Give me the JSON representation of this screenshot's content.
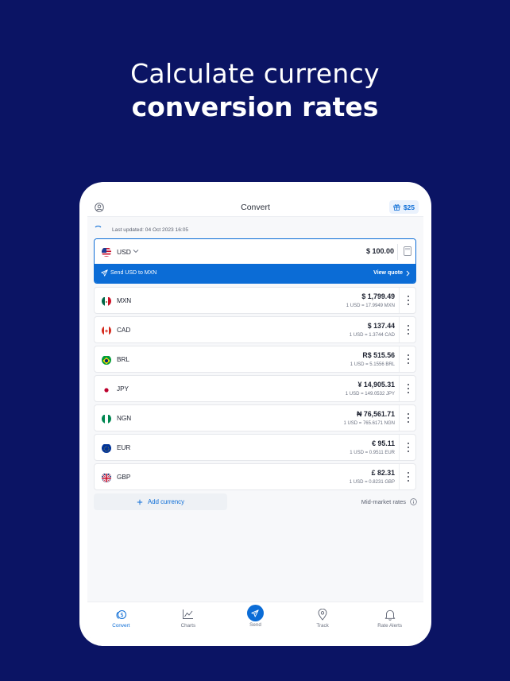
{
  "headline": {
    "line1": "Calculate currency",
    "line2": "conversion rates"
  },
  "header": {
    "title": "Convert",
    "reward": "$25"
  },
  "status": {
    "last_updated": "Last updated: 04 Oct 2023 16:05"
  },
  "base": {
    "code": "USD",
    "amount": "$ 100.00",
    "send_text": "Send USD to MXN",
    "view_quote": "View quote"
  },
  "currencies": [
    {
      "code": "MXN",
      "value": "$ 1,799.49",
      "rate": "1 USD = 17.9949 MXN"
    },
    {
      "code": "CAD",
      "value": "$ 137.44",
      "rate": "1 USD = 1.3744 CAD"
    },
    {
      "code": "BRL",
      "value": "R$ 515.56",
      "rate": "1 USD = 5.1556 BRL"
    },
    {
      "code": "JPY",
      "value": "¥ 14,905.31",
      "rate": "1 USD = 149.0532 JPY"
    },
    {
      "code": "NGN",
      "value": "₦ 76,561.71",
      "rate": "1 USD = 765.6171 NGN"
    },
    {
      "code": "EUR",
      "value": "€ 95.11",
      "rate": "1 USD = 0.9511 EUR"
    },
    {
      "code": "GBP",
      "value": "£ 82.31",
      "rate": "1 USD = 0.8231 GBP"
    }
  ],
  "actions": {
    "add_currency": "Add currency",
    "mid_market": "Mid-market rates"
  },
  "tabs": [
    {
      "label": "Convert"
    },
    {
      "label": "Charts"
    },
    {
      "label": "Send"
    },
    {
      "label": "Track"
    },
    {
      "label": "Rate Alerts"
    }
  ],
  "colors": {
    "background": "#0b1464",
    "accent": "#0b6cd6"
  }
}
